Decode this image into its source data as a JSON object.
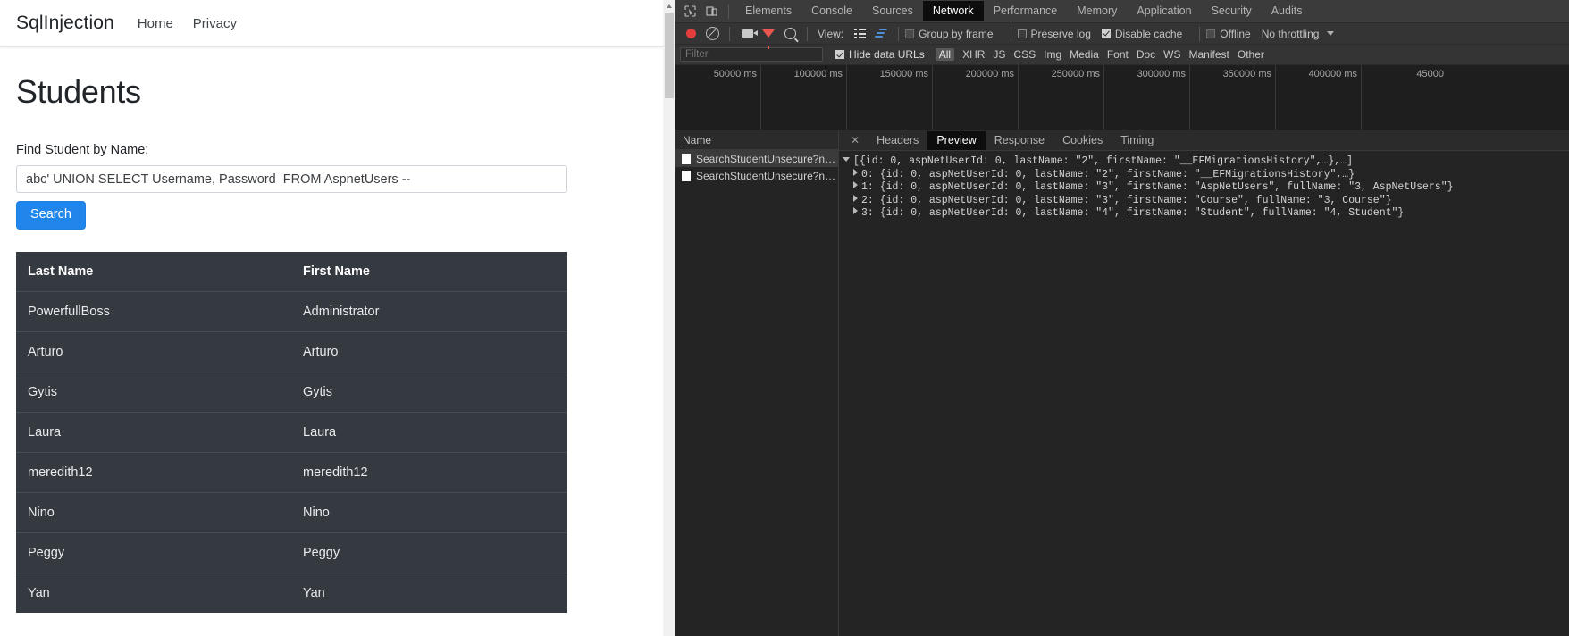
{
  "page": {
    "navbar": {
      "brand": "SqlInjection",
      "links": [
        "Home",
        "Privacy"
      ]
    },
    "title": "Students",
    "form": {
      "label": "Find Student by Name:",
      "input_value": "abc' UNION SELECT Username, Password  FROM AspnetUsers --",
      "input_placeholder": "",
      "search_button": "Search"
    },
    "table": {
      "columns": [
        "Last Name",
        "First Name"
      ],
      "rows": [
        [
          "PowerfullBoss",
          "Administrator"
        ],
        [
          "Arturo",
          "Arturo"
        ],
        [
          "Gytis",
          "Gytis"
        ],
        [
          "Laura",
          "Laura"
        ],
        [
          "meredith12",
          "meredith12"
        ],
        [
          "Nino",
          "Nino"
        ],
        [
          "Peggy",
          "Peggy"
        ],
        [
          "Yan",
          "Yan"
        ]
      ]
    }
  },
  "devtools": {
    "tabs": [
      {
        "label": "Elements",
        "active": false
      },
      {
        "label": "Console",
        "active": false
      },
      {
        "label": "Sources",
        "active": false
      },
      {
        "label": "Network",
        "active": true
      },
      {
        "label": "Performance",
        "active": false
      },
      {
        "label": "Memory",
        "active": false
      },
      {
        "label": "Application",
        "active": false
      },
      {
        "label": "Security",
        "active": false
      },
      {
        "label": "Audits",
        "active": false
      }
    ],
    "toolbar": {
      "record_icon": "record-dot-icon",
      "clear_icon": "clear-icon",
      "camera_icon": "camera-icon",
      "filter_icon": "filter-funnel-icon",
      "search_icon": "search-icon",
      "view_label": "View:",
      "group_by_frame": {
        "label": "Group by frame",
        "checked": false
      },
      "preserve_log": {
        "label": "Preserve log",
        "checked": false
      },
      "disable_cache": {
        "label": "Disable cache",
        "checked": true
      },
      "offline": {
        "label": "Offline",
        "checked": false
      },
      "throttling": "No throttling"
    },
    "filterbar": {
      "placeholder": "Filter",
      "value": "",
      "hide_data_urls": {
        "label": "Hide data URLs",
        "checked": true
      },
      "types": [
        "All",
        "XHR",
        "JS",
        "CSS",
        "Img",
        "Media",
        "Font",
        "Doc",
        "WS",
        "Manifest",
        "Other"
      ],
      "active_type": "All"
    },
    "overview": {
      "ticks": [
        "50000 ms",
        "100000 ms",
        "150000 ms",
        "200000 ms",
        "250000 ms",
        "300000 ms",
        "350000 ms",
        "400000 ms",
        "45000"
      ]
    },
    "requests": {
      "header": "Name",
      "items": [
        {
          "name": "SearchStudentUnsecure?name…",
          "selected": true
        },
        {
          "name": "SearchStudentUnsecure?name…",
          "selected": false
        }
      ]
    },
    "detail": {
      "close_icon": "close-icon",
      "tabs": [
        {
          "label": "Headers",
          "active": false
        },
        {
          "label": "Preview",
          "active": true
        },
        {
          "label": "Response",
          "active": false
        },
        {
          "label": "Cookies",
          "active": false
        },
        {
          "label": "Timing",
          "active": false
        }
      ],
      "preview_lines": [
        "[{id: 0, aspNetUserId: 0, lastName: \"2\", firstName: \"__EFMigrationsHistory\",…},…]",
        "0: {id: 0, aspNetUserId: 0, lastName: \"2\", firstName: \"__EFMigrationsHistory\",…}",
        "1: {id: 0, aspNetUserId: 0, lastName: \"3\", firstName: \"AspNetUsers\", fullName: \"3, AspNetUsers\"}",
        "2: {id: 0, aspNetUserId: 0, lastName: \"3\", firstName: \"Course\", fullName: \"3, Course\"}",
        "3: {id: 0, aspNetUserId: 0, lastName: \"4\", firstName: \"Student\", fullName: \"4, Student\"}"
      ]
    }
  },
  "colors": {
    "accent": "#2186ec",
    "table_bg": "#343a40",
    "devtools_bg": "#242424",
    "record_red": "#e33d3d"
  }
}
